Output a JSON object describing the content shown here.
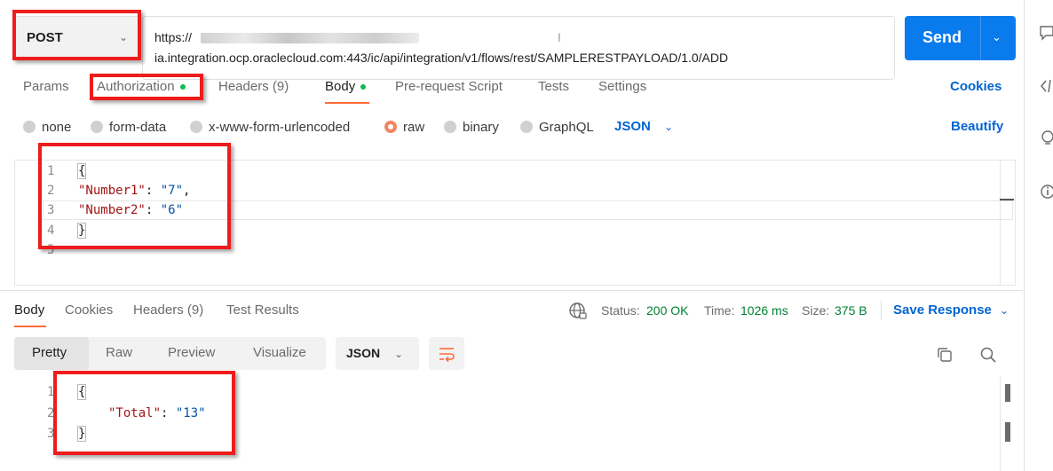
{
  "request": {
    "method": "POST",
    "url_line1": "https://",
    "url_line2": "ia.integration.ocp.oraclecloud.com:443/ic/api/integration/v1/flows/rest/SAMPLERESTPAYLOAD/1.0/ADD",
    "send_label": "Send"
  },
  "request_tabs": {
    "params": "Params",
    "authorization": "Authorization",
    "headers": "Headers (9)",
    "body": "Body",
    "prerequest": "Pre-request Script",
    "tests": "Tests",
    "settings": "Settings",
    "cookies": "Cookies"
  },
  "body_types": {
    "none": "none",
    "form_data": "form-data",
    "urlencoded": "x-www-form-urlencoded",
    "raw": "raw",
    "binary": "binary",
    "graphql": "GraphQL",
    "format": "JSON",
    "beautify": "Beautify"
  },
  "request_body": {
    "line_numbers": [
      "1",
      "2",
      "3",
      "4",
      "5"
    ],
    "open_brace": "{",
    "key1": "\"Number1\"",
    "val1": "\"7\"",
    "key2": "\"Number2\"",
    "val2": "\"6\"",
    "close_brace": "}"
  },
  "response_tabs": {
    "body": "Body",
    "cookies": "Cookies",
    "headers": "Headers (9)",
    "test_results": "Test Results"
  },
  "response_status": {
    "status_label": "Status:",
    "status_value": "200 OK",
    "time_label": "Time:",
    "time_value": "1026 ms",
    "size_label": "Size:",
    "size_value": "375 B",
    "save_response": "Save Response"
  },
  "response_view": {
    "pretty": "Pretty",
    "raw": "Raw",
    "preview": "Preview",
    "visualize": "Visualize",
    "format": "JSON"
  },
  "response_body": {
    "line_numbers": [
      "1",
      "2",
      "3"
    ],
    "open_brace": "{",
    "key": "\"Total\"",
    "value": "\"13\"",
    "close_brace": "}"
  },
  "colors": {
    "accent_orange": "#ff6c37",
    "send_blue": "#097bed",
    "link_blue": "#0265d2",
    "status_green": "#007f31",
    "annotation_red": "#ee1c1c"
  }
}
